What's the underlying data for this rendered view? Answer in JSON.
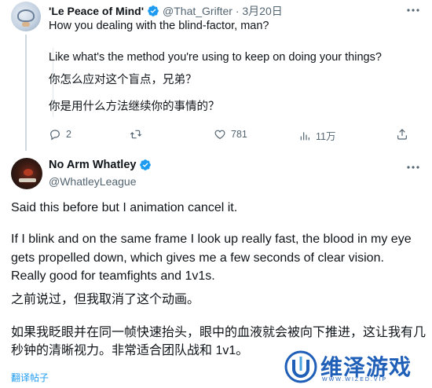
{
  "top_tweet": {
    "display_name": "'Le Peace of Mind'",
    "handle_date": "@That_Grifter · 3月20日",
    "line1": "How you dealing with the blind-factor, man?",
    "line2": "Like what's the method you're using to keep on doing your things?",
    "line3": "你怎么应对这个盲点，兄弟？",
    "line4": "你是用什么方法继续你的事情的？",
    "stats": {
      "replies": "2",
      "retweets": "",
      "likes": "781",
      "views": "11万"
    }
  },
  "main_tweet": {
    "display_name": "No Arm Whatley",
    "handle": "@WhatleyLeague",
    "para1": "Said this before but I animation cancel it.",
    "para2_line1": "If I blink and on the same frame I look up really fast, the blood in my eye",
    "para2_line2": "gets propelled down, which gives me a few seconds of clear vision.",
    "para2_line3": "Really good for teamfights and 1v1s.",
    "para3": "之前说过，但我取消了这个动画。",
    "para4_line1": "如果我眨眼并在同一帧快速抬头，眼中的血液就会被向下推进，这让我有几",
    "para4_line2": "秒钟的清晰视力。非常适合团队战和 1v1。",
    "translate_label": "翻译帖子"
  },
  "watermark": {
    "text": "维泽游戏",
    "sub": "WWW.WIZED.VIP"
  },
  "colors": {
    "text": "#0f1419",
    "secondary": "#536471",
    "accent": "#1d9bf0",
    "verified": "#1d9bf0",
    "watermark": "#1f5fb8"
  }
}
